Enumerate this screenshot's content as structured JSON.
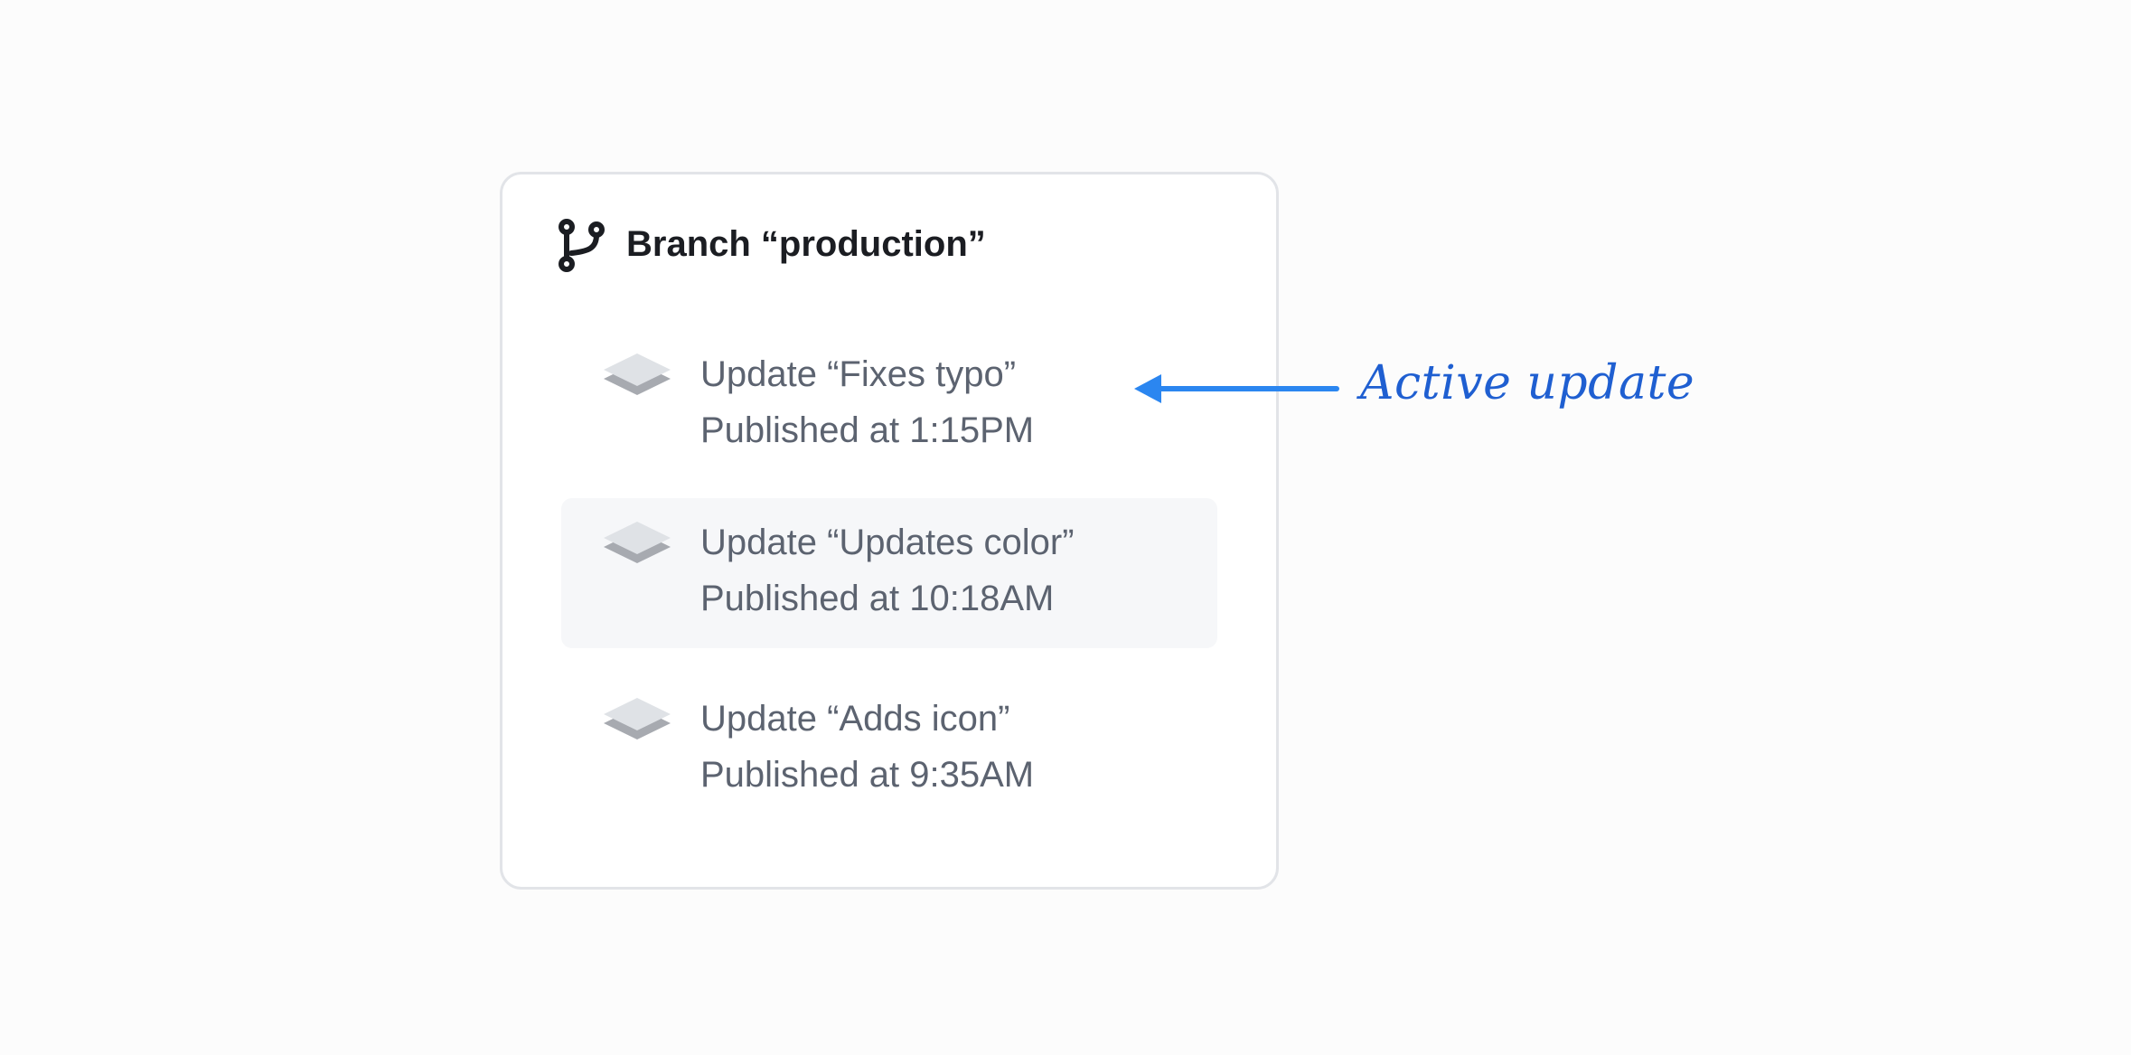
{
  "branch": {
    "icon": "git-branch-icon",
    "title": "Branch “production”"
  },
  "updates": [
    {
      "icon": "layers-icon",
      "title": "Update “Fixes typo”",
      "published": "Published at 1:15PM"
    },
    {
      "icon": "layers-icon",
      "title": "Update “Updates color”",
      "published": "Published at 10:18AM"
    },
    {
      "icon": "layers-icon",
      "title": "Update “Adds icon”",
      "published": "Published at 9:35AM"
    }
  ],
  "annotation": {
    "label": "Active update",
    "color": "#1f5fd1",
    "arrow_color": "#2b86f0"
  },
  "colors": {
    "card_border": "#e2e4e8",
    "highlight_bg": "#f6f7f9",
    "text_primary": "#1b1d22",
    "text_secondary": "#5c6370",
    "layer_top": "#dfe2e6",
    "layer_bottom": "#a7aab0"
  }
}
